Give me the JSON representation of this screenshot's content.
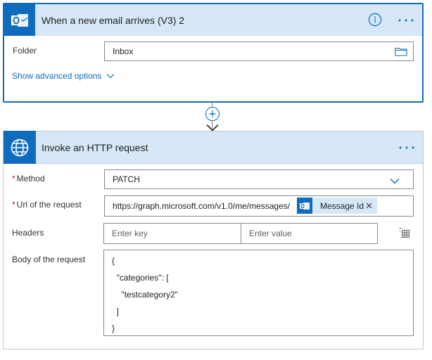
{
  "trigger": {
    "title": "When a new email arrives (V3) 2",
    "app_icon": "outlook-icon",
    "info_icon": "info-icon",
    "more_icon": "ellipsis-icon",
    "folder_label": "Folder",
    "folder_value": "Inbox",
    "folder_picker_icon": "folder-icon",
    "advanced_link": "Show advanced options",
    "advanced_chevron_icon": "chevron-down-icon"
  },
  "connector": {
    "add_icon": "plus-icon",
    "arrow_icon": "arrow-down-icon"
  },
  "action": {
    "title": "Invoke an HTTP request",
    "app_icon": "globe-icon",
    "more_icon": "ellipsis-icon",
    "required_marker": "*",
    "method_label": "Method",
    "method_value": "PATCH",
    "method_dropdown_icon": "chevron-down-icon",
    "url_label": "Url of the request",
    "url_value": "https://graph.microsoft.com/v1.0/me/messages/",
    "url_token": {
      "label": "Message Id",
      "icon": "outlook-icon",
      "remove_icon": "close-icon"
    },
    "headers_label": "Headers",
    "header_key_placeholder": "Enter key",
    "header_value_placeholder": "Enter value",
    "headers_mode_icon": "switch-to-text-mode-icon",
    "body_label": "Body of the request",
    "body_lines": [
      "{",
      "  \"categories\": [",
      "    \"testcategory2\"",
      "  ]",
      "}"
    ]
  },
  "colors": {
    "accent": "#0f6cbd",
    "header_background": "#d6e8f7",
    "required": "#a4262c",
    "border": "#8a8886"
  }
}
